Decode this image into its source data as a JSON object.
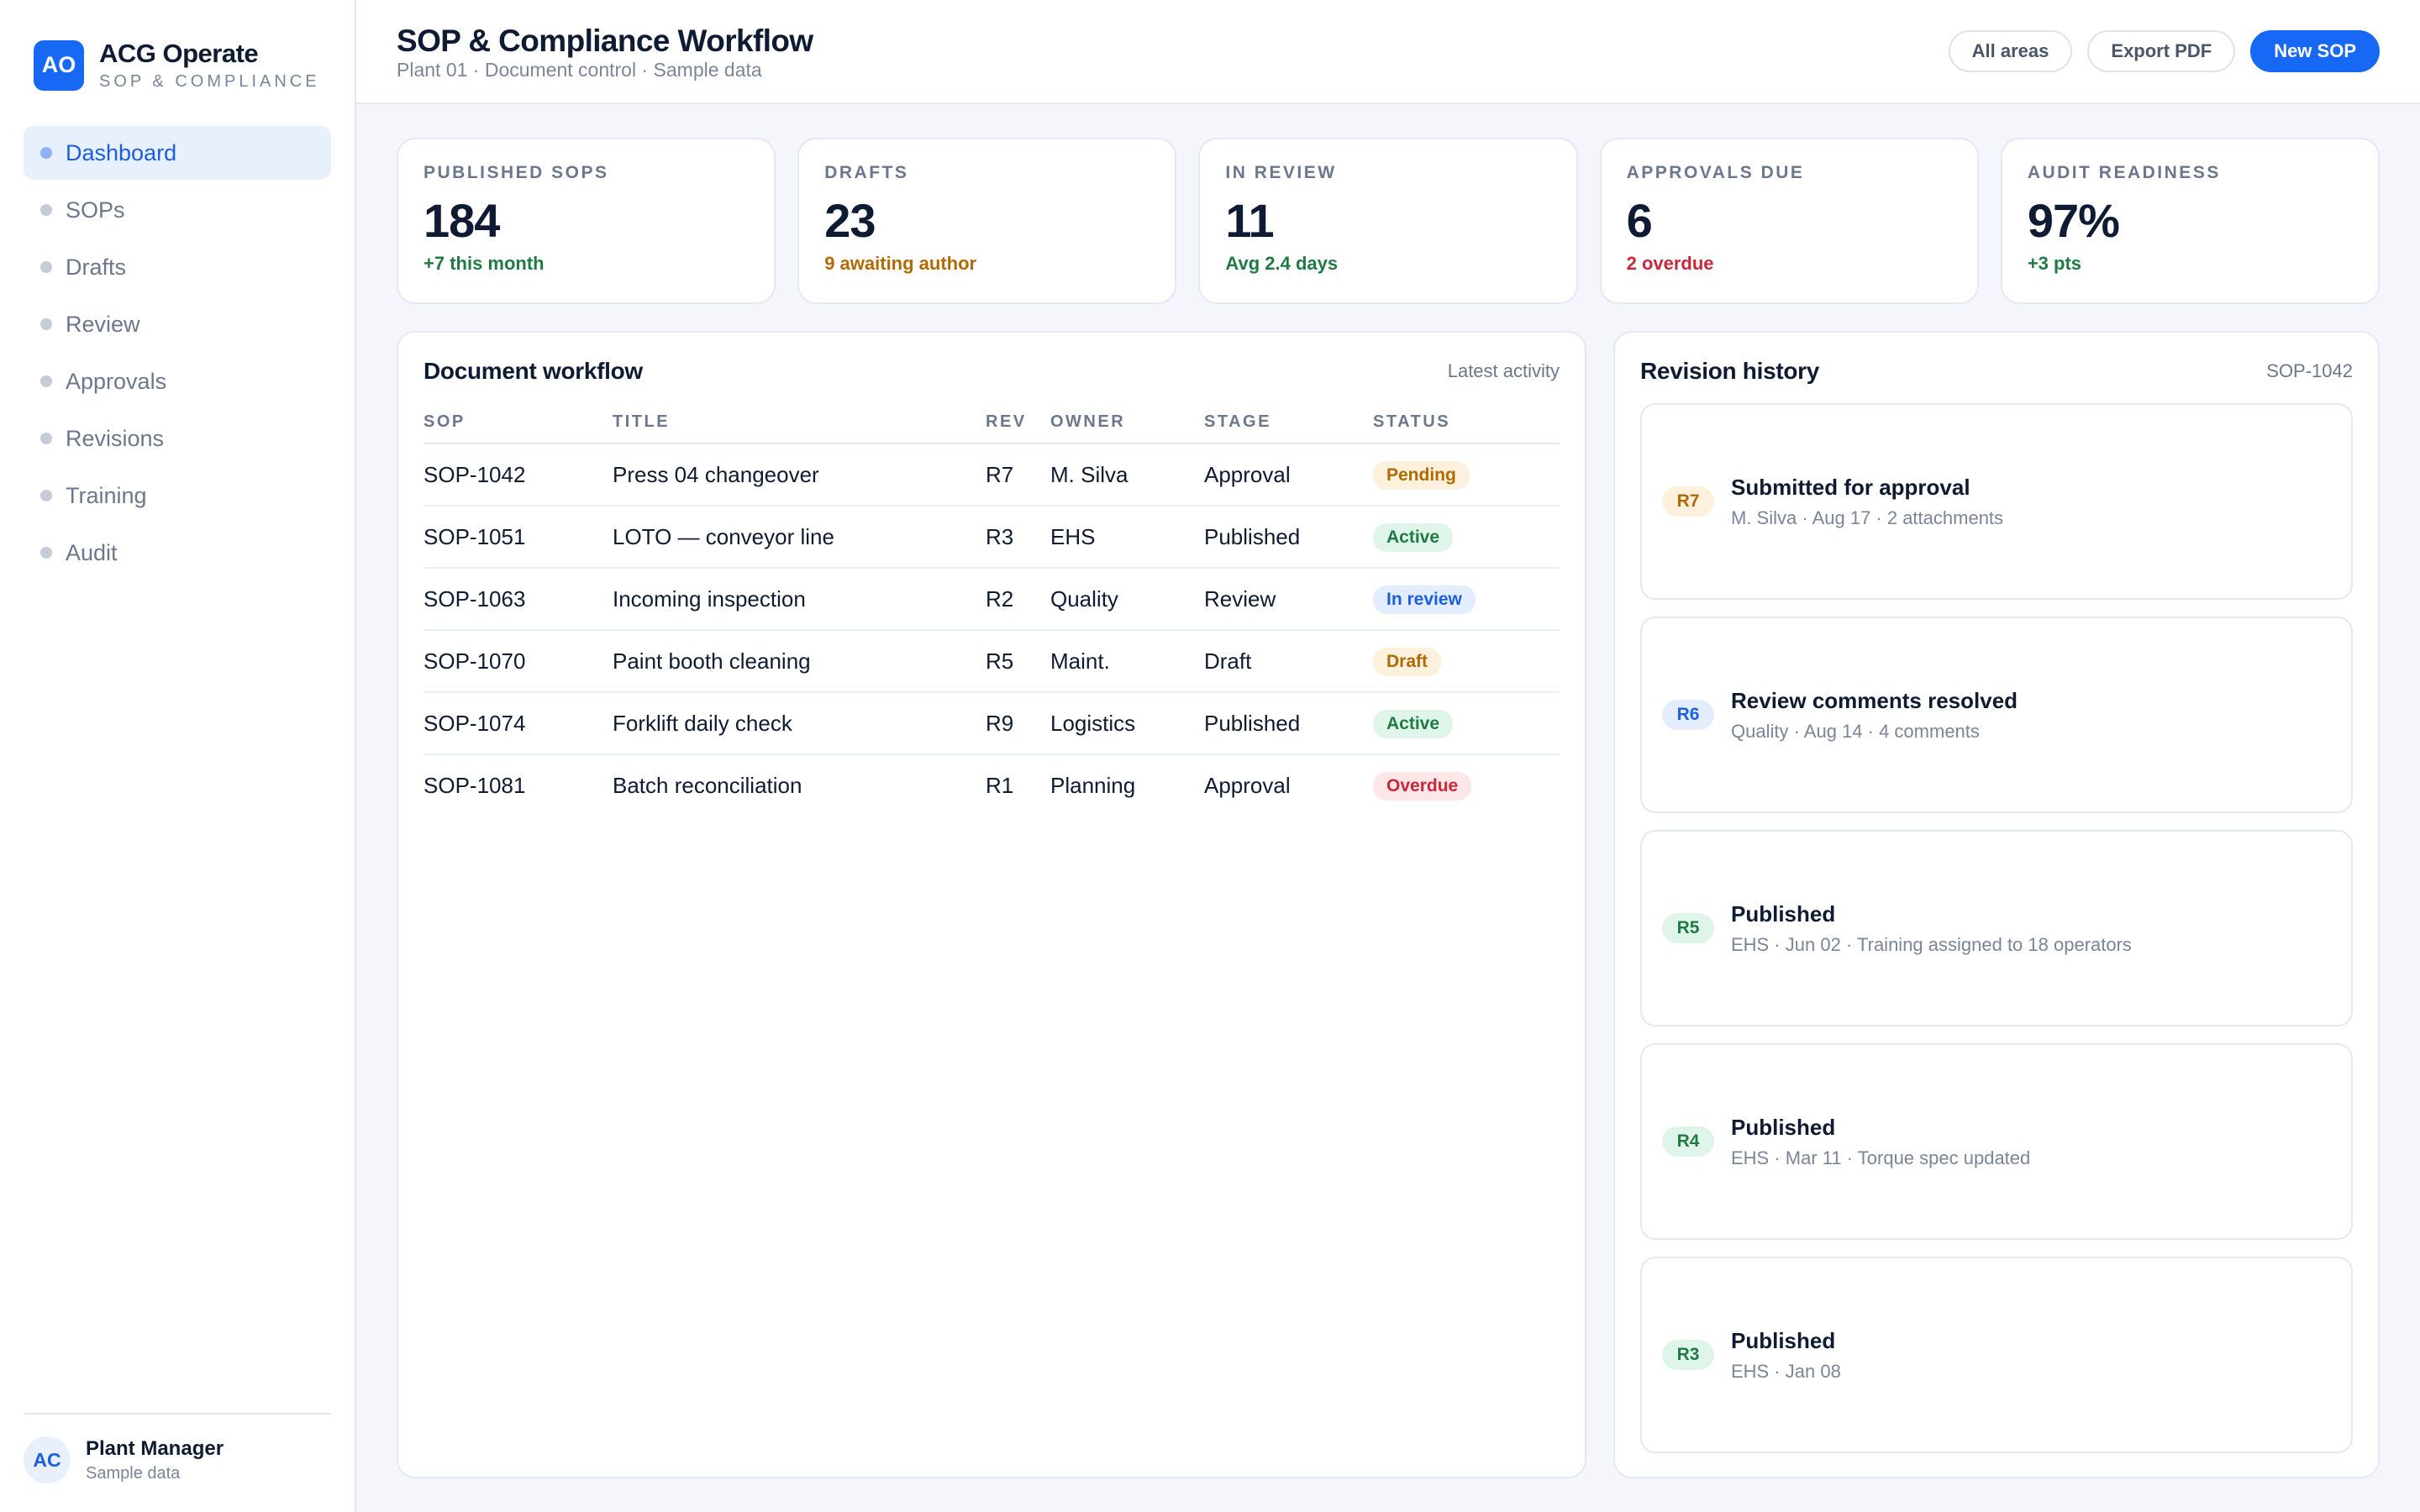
{
  "brand": {
    "logo": "AO",
    "title": "ACG Operate",
    "subtitle": "SOP & COMPLIANCE"
  },
  "nav": [
    {
      "label": "Dashboard",
      "active": true
    },
    {
      "label": "SOPs"
    },
    {
      "label": "Drafts"
    },
    {
      "label": "Review"
    },
    {
      "label": "Approvals"
    },
    {
      "label": "Revisions"
    },
    {
      "label": "Training"
    },
    {
      "label": "Audit"
    }
  ],
  "user": {
    "initials": "AC",
    "name": "Plant Manager",
    "sub": "Sample data"
  },
  "header": {
    "title": "SOP & Compliance Workflow",
    "subtitle": "Plant 01 · Document control · Sample data",
    "buttons": {
      "areas": "All areas",
      "export": "Export PDF",
      "new": "New SOP"
    }
  },
  "kpis": [
    {
      "label": "PUBLISHED SOPS",
      "value": "184",
      "note": "+7 this month",
      "note_color": "#1f7a44"
    },
    {
      "label": "DRAFTS",
      "value": "23",
      "note": "9 awaiting author",
      "note_color": "#b06a00"
    },
    {
      "label": "IN REVIEW",
      "value": "11",
      "note": "Avg 2.4 days",
      "note_color": "#1f7a44"
    },
    {
      "label": "APPROVALS DUE",
      "value": "6",
      "note": "2 overdue",
      "note_color": "#c9283a"
    },
    {
      "label": "AUDIT READINESS",
      "value": "97%",
      "note": "+3 pts",
      "note_color": "#1f7a44"
    }
  ],
  "workflow": {
    "title": "Document workflow",
    "aside": "Latest activity",
    "columns": [
      "SOP",
      "TITLE",
      "REV",
      "OWNER",
      "STAGE",
      "STATUS"
    ],
    "rows": [
      {
        "sop": "SOP-1042",
        "title": "Press 04 changeover",
        "rev": "R7",
        "owner": "M. Silva",
        "stage": "Approval",
        "status": "Pending"
      },
      {
        "sop": "SOP-1051",
        "title": "LOTO — conveyor line",
        "rev": "R3",
        "owner": "EHS",
        "stage": "Published",
        "status": "Active"
      },
      {
        "sop": "SOP-1063",
        "title": "Incoming inspection",
        "rev": "R2",
        "owner": "Quality",
        "stage": "Review",
        "status": "In review"
      },
      {
        "sop": "SOP-1070",
        "title": "Paint booth cleaning",
        "rev": "R5",
        "owner": "Maint.",
        "stage": "Draft",
        "status": "Draft"
      },
      {
        "sop": "SOP-1074",
        "title": "Forklift daily check",
        "rev": "R9",
        "owner": "Logistics",
        "stage": "Published",
        "status": "Active"
      },
      {
        "sop": "SOP-1081",
        "title": "Batch reconciliation",
        "rev": "R1",
        "owner": "Planning",
        "stage": "Approval",
        "status": "Overdue"
      }
    ]
  },
  "history": {
    "title": "Revision history",
    "aside": "SOP-1042",
    "items": [
      {
        "tag": "R7",
        "tone": "amber",
        "title": "Submitted for approval",
        "meta": "M. Silva · Aug 17 · 2 attachments"
      },
      {
        "tag": "R6",
        "tone": "blue",
        "title": "Review comments resolved",
        "meta": "Quality · Aug 14 · 4 comments"
      },
      {
        "tag": "R5",
        "tone": "green",
        "title": "Published",
        "meta": "EHS · Jun 02 · Training assigned to 18 operators"
      },
      {
        "tag": "R4",
        "tone": "green",
        "title": "Published",
        "meta": "EHS · Mar 11 · Torque spec updated"
      },
      {
        "tag": "R3",
        "tone": "green",
        "title": "Published",
        "meta": "EHS · Jan 08"
      }
    ]
  }
}
